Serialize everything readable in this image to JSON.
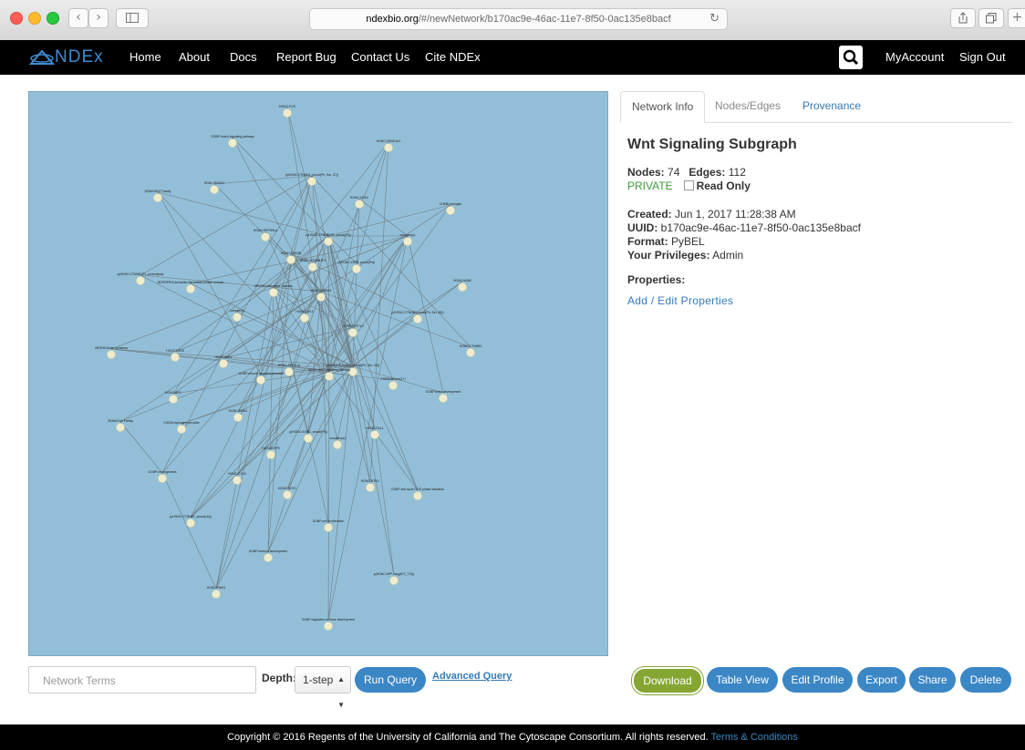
{
  "browser": {
    "url_host": "ndexbio.org",
    "url_path": "/#/newNetwork/b170ac9e-46ac-11e7-8f50-0ac135e8bacf"
  },
  "navbar": {
    "logo": "NDEx",
    "links": [
      "Home",
      "About",
      "Docs",
      "Report Bug",
      "Contact Us",
      "Cite NDEx"
    ],
    "my_account": "MyAccount",
    "sign_out": "Sign Out"
  },
  "tabs": {
    "network_info": "Network Info",
    "nodes_edges": "Nodes/Edges",
    "provenance": "Provenance"
  },
  "network": {
    "title": "Wnt Signaling Subgraph",
    "nodes_label": "Nodes:",
    "nodes": "74",
    "edges_label": "Edges:",
    "edges": "112",
    "visibility": "PRIVATE",
    "read_only": "Read Only",
    "created_label": "Created:",
    "created": "Jun 1, 2017 11:28:38 AM",
    "uuid_label": "UUID:",
    "uuid": "b170ac9e-46ac-11e7-8f50-0ac135e8bacf",
    "format_label": "Format:",
    "format": "PyBEL",
    "privileges_label": "Your Privileges:",
    "privileges": "Admin",
    "properties_label": "Properties:",
    "edit_properties": "Add / Edit Properties"
  },
  "query": {
    "placeholder": "Network Terms",
    "depth_label": "Depth:",
    "depth_value": "1-step",
    "run": "Run Query",
    "advanced": "Advanced Query"
  },
  "actions": {
    "download": "Download",
    "table_view": "Table View",
    "edit_profile": "Edit Profile",
    "export": "Export",
    "share": "Share",
    "delete": "Delete"
  },
  "colors": {
    "canvas_bg": "#92bfd7",
    "node": "#efeccd",
    "edge": "#6f7f87",
    "accent_blue": "#3b87c6",
    "download_green": "#86a634"
  },
  "graph": {
    "nodes": [
      {
        "label": "HGNC:FOS"
      },
      {
        "label": "GOBP:Notch signaling pathway"
      },
      {
        "label": "HGNC:CSNK1A1"
      },
      {
        "label": "p(HGNC:CTNNB1, pmod(Ph, Ser, 37))"
      },
      {
        "label": "SFAM:WNT Family"
      },
      {
        "label": "HGNC:ROCK1"
      },
      {
        "label": "HGNC:CDH2"
      },
      {
        "label": "CHEBI:estrogen"
      },
      {
        "label": "HGNC:PPP2R1A"
      },
      {
        "label": "p(HGNC:CTNNB1P1, pmod(Ph))"
      },
      {
        "label": "complex(p)"
      },
      {
        "label": "HGNC:GSK3B"
      },
      {
        "label": "HGNC:CTNNB1P1"
      },
      {
        "label": "p(HGNC:LRP6, pmod(Ph))"
      },
      {
        "label": "p(HGNC:CTNNB1P1, proteolysis)"
      },
      {
        "label": "INTERPRO:Armadillo-like helical protein domain"
      },
      {
        "label": "MESHD:Alzheimer Disease"
      },
      {
        "label": "HGNC:SMAD3"
      },
      {
        "label": "HGNC:NAB2"
      },
      {
        "label": "complex(t)"
      },
      {
        "label": "HGNC:DVL2"
      },
      {
        "label": "p(HGNC:CTNNB1 pmod(Ph, Ser, 45))"
      },
      {
        "label": "HGNC:TCF7L2"
      },
      {
        "label": "HGNC:CTNNB1"
      },
      {
        "label": "MESHD:Brain Ischemia"
      },
      {
        "label": "HGNC:FZD5"
      },
      {
        "label": "HGNC:WIF1"
      },
      {
        "label": "HGNC:PPP1CA"
      },
      {
        "label": "p(HGNC:CTNNB1, pmod(Ph, Ser, 33))"
      },
      {
        "label": "KEGG:WNT signaling pathway"
      },
      {
        "label": "GOBP:neuron apoptotic process"
      },
      {
        "label": "CHEBI:lithium(1+)"
      },
      {
        "label": "HGNC:APC"
      },
      {
        "label": "GOBP:brain development"
      },
      {
        "label": "HGNC:AXIN1"
      },
      {
        "label": "SFAM:DVL Family"
      },
      {
        "label": "CHEBI:hydrogen peroxide"
      },
      {
        "label": "HGNC:DVL1"
      },
      {
        "label": "p(HGNC:AXIN1, pmod(Ph))"
      },
      {
        "label": "complex(w)"
      },
      {
        "label": "HGNC:LRP5"
      },
      {
        "label": "GOBP:neurogenesis"
      },
      {
        "label": "HGNC:CYLD"
      },
      {
        "label": "HGNC:BTRC"
      },
      {
        "label": "GOBP:cell cycle G1/S phase transition"
      },
      {
        "label": "HGNC:SOX1"
      },
      {
        "label": "p(HGNC:CTNNB1, pmod(Ub))"
      },
      {
        "label": "GOBP:cell proliferation"
      },
      {
        "label": "GOBP:embryo development"
      },
      {
        "label": "p(HGNC:APP, frag(672_713))"
      },
      {
        "label": "HGNC:PIAS1"
      },
      {
        "label": "GOBP:regulation of bone development"
      }
    ]
  }
}
